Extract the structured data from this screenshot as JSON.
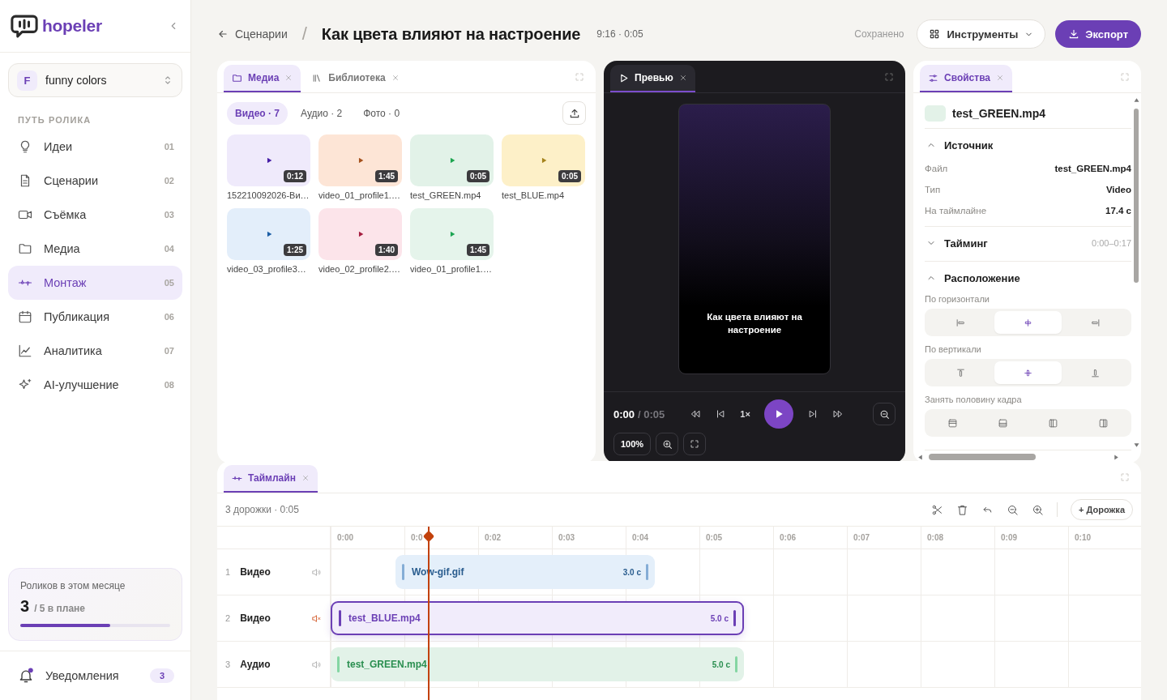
{
  "brand": {
    "name": "hopeler"
  },
  "project": {
    "initial": "F",
    "name": "funny colors"
  },
  "nav": {
    "heading": "ПУТЬ РОЛИКА",
    "items": [
      {
        "label": "Идеи",
        "number": "01",
        "selected": false
      },
      {
        "label": "Сценарии",
        "number": "02",
        "selected": false
      },
      {
        "label": "Съёмка",
        "number": "03",
        "selected": false
      },
      {
        "label": "Медиа",
        "number": "04",
        "selected": false
      },
      {
        "label": "Монтаж",
        "number": "05",
        "selected": true
      },
      {
        "label": "Публикация",
        "number": "06",
        "selected": false
      },
      {
        "label": "Аналитика",
        "number": "07",
        "selected": false
      },
      {
        "label": "AI-улучшение",
        "number": "08",
        "selected": false
      }
    ]
  },
  "quota": {
    "label": "Роликов в этом месяце",
    "count": "3",
    "plan": "/ 5 в плане",
    "level": 0.6
  },
  "notifications": {
    "label": "Уведомления",
    "count": "3",
    "unread": true
  },
  "header": {
    "back": "Сценарии",
    "separator": "/",
    "title": "Как цвета влияют на настроение",
    "meta": "9:16 · 0:05",
    "status": "Сохранено",
    "tools": "Инструменты",
    "export": "Экспорт"
  },
  "media_panel": {
    "tabs": [
      {
        "label": "Медиа",
        "selected": true
      },
      {
        "label": "Библиотека",
        "selected": false
      }
    ],
    "filters": [
      {
        "label": "Видео · 7",
        "selected": true
      },
      {
        "label": "Аудио · 2",
        "selected": false
      },
      {
        "label": "Фото · 0",
        "selected": false
      }
    ],
    "files": [
      {
        "name": "152210092026-Ви…",
        "duration": "0:12",
        "color": "#efeafb"
      },
      {
        "name": "video_01_profile1.…",
        "duration": "1:45",
        "color": "#fde5d6"
      },
      {
        "name": "test_GREEN.mp4",
        "duration": "0:05",
        "color": "#e2f2e8"
      },
      {
        "name": "test_BLUE.mp4",
        "duration": "0:05",
        "color": "#fdf0c8"
      },
      {
        "name": "video_03_profile3…",
        "duration": "1:25",
        "color": "#e3eefa"
      },
      {
        "name": "video_02_profile2.…",
        "duration": "1:40",
        "color": "#fce4ea"
      },
      {
        "name": "video_01_profile1.…",
        "duration": "1:45",
        "color": "#e5f4eb"
      }
    ]
  },
  "preview_panel": {
    "tab": {
      "label": "Превью",
      "selected": true
    },
    "caption": "Как цвета влияют на настроение",
    "current_time": "0:00",
    "total_time": "/ 0:05",
    "speed": "1×",
    "zoom": "100%"
  },
  "properties_panel": {
    "tab": {
      "label": "Свойства",
      "selected": true
    },
    "file_name": "test_GREEN.mp4",
    "sections": [
      {
        "title": "Источник",
        "expanded": true,
        "rows": [
          {
            "label": "Файл",
            "value": "test_GREEN.mp4"
          },
          {
            "label": "Тип",
            "value": "Video"
          },
          {
            "label": "На таймлайне",
            "value": "17.4 с"
          }
        ]
      },
      {
        "title": "Тайминг",
        "expanded": false,
        "summary": "0:00–0:17"
      },
      {
        "title": "Расположение",
        "expanded": true,
        "groups": [
          {
            "label": "По горизонтали",
            "options": [
              {
                "selected": false
              },
              {
                "selected": true
              },
              {
                "selected": false
              }
            ]
          },
          {
            "label": "По вертикали",
            "options": [
              {
                "selected": false
              },
              {
                "selected": true
              },
              {
                "selected": false
              }
            ]
          },
          {
            "label": "Занять половину кадра",
            "options": [
              {
                "selected": false
              },
              {
                "selected": false
              },
              {
                "selected": false
              },
              {
                "selected": false
              }
            ]
          }
        ]
      }
    ]
  },
  "timeline": {
    "tab": {
      "label": "Таймлайн",
      "selected": true
    },
    "summary": "3 дорожки · 0:05",
    "add_track": "+ Дорожка",
    "ticks": [
      "0:00",
      "0:0",
      "0:02",
      "0:03",
      "0:04",
      "0:05",
      "0:06",
      "0:07",
      "0:08",
      "0:09",
      "0:10"
    ],
    "tracks": [
      {
        "number": "1",
        "name": "Видео",
        "muted": false,
        "clip": {
          "name": "Wow-gif.gif",
          "duration": "3.0 с",
          "color": "#e4effa",
          "selected": false
        }
      },
      {
        "number": "2",
        "name": "Видео",
        "muted": true,
        "clip": {
          "name": "test_BLUE.mp4",
          "duration": "5.0 с",
          "color": "#f1ecfb",
          "selected": true
        }
      },
      {
        "number": "3",
        "name": "Аудио",
        "muted": false,
        "clip": {
          "name": "test_GREEN.mp4",
          "duration": "5.0 с",
          "color": "#e2f2e8",
          "selected": false
        }
      }
    ]
  }
}
